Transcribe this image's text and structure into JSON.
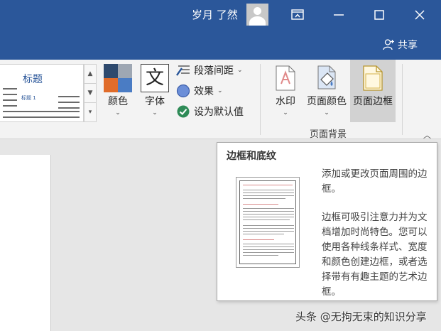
{
  "titlebar": {
    "user_name": "岁月 了然",
    "share_label": "共享"
  },
  "ribbon": {
    "style_gallery": {
      "title_sample": "标题",
      "subtitle_sample": "标题 1"
    },
    "colors_label": "颜色",
    "fonts_label": "字体",
    "fonts_glyph": "文",
    "paragraph_spacing_label": "段落间距",
    "effects_label": "效果",
    "set_default_label": "设为默认值",
    "watermark_label": "水印",
    "page_color_label": "页面颜色",
    "page_borders_label": "页面边框",
    "group_label": "页面背景"
  },
  "tooltip": {
    "title": "边框和底纹",
    "paragraph1": "添加或更改页面周围的边框。",
    "paragraph2": "边框可吸引注意力并为文档增加时尚特色。您可以使用各种线条样式、宽度和颜色创建边框，或者选择带有有趣主题的艺术边框。"
  },
  "watermark_text": "头条 @无拘无束的知识分享",
  "colors": {
    "title_bar": "#2b579a",
    "ribbon_bg": "#f3f3f3",
    "selected_button": "#d2d2d2",
    "swatch_navy": "#2e4a6e",
    "swatch_orange": "#e06c2a",
    "swatch_blue": "#4a7cc4",
    "swatch_gray": "#9ea7b3"
  }
}
